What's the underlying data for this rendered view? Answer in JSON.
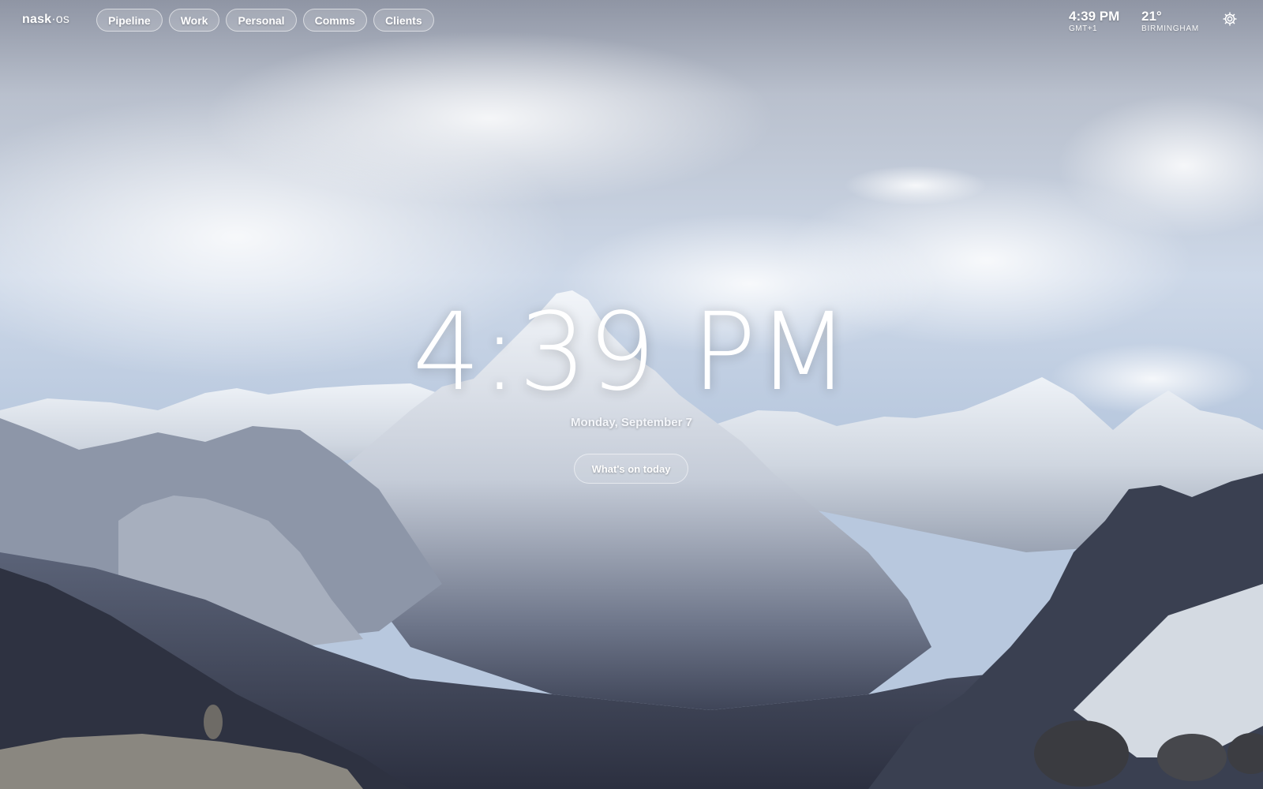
{
  "logo": {
    "main": "nask",
    "suffix": "·os"
  },
  "tabs": [
    {
      "label": "Pipeline"
    },
    {
      "label": "Work"
    },
    {
      "label": "Personal"
    },
    {
      "label": "Comms"
    },
    {
      "label": "Clients"
    }
  ],
  "header_clock": {
    "time": "4:39 PM",
    "timezone": "GMT+1"
  },
  "weather": {
    "temperature": "21°",
    "city": "BIRMINGHAM"
  },
  "settings": {
    "icon": "gear-icon"
  },
  "main": {
    "time": "4:39 PM",
    "date": "Monday, September 7",
    "today_button": "What's on today"
  },
  "background": {
    "description_icon": "mountain-landscape",
    "sky_color": "#c4d2e6",
    "snow_color": "#e8edf4",
    "rock_color": "#4a5266"
  }
}
